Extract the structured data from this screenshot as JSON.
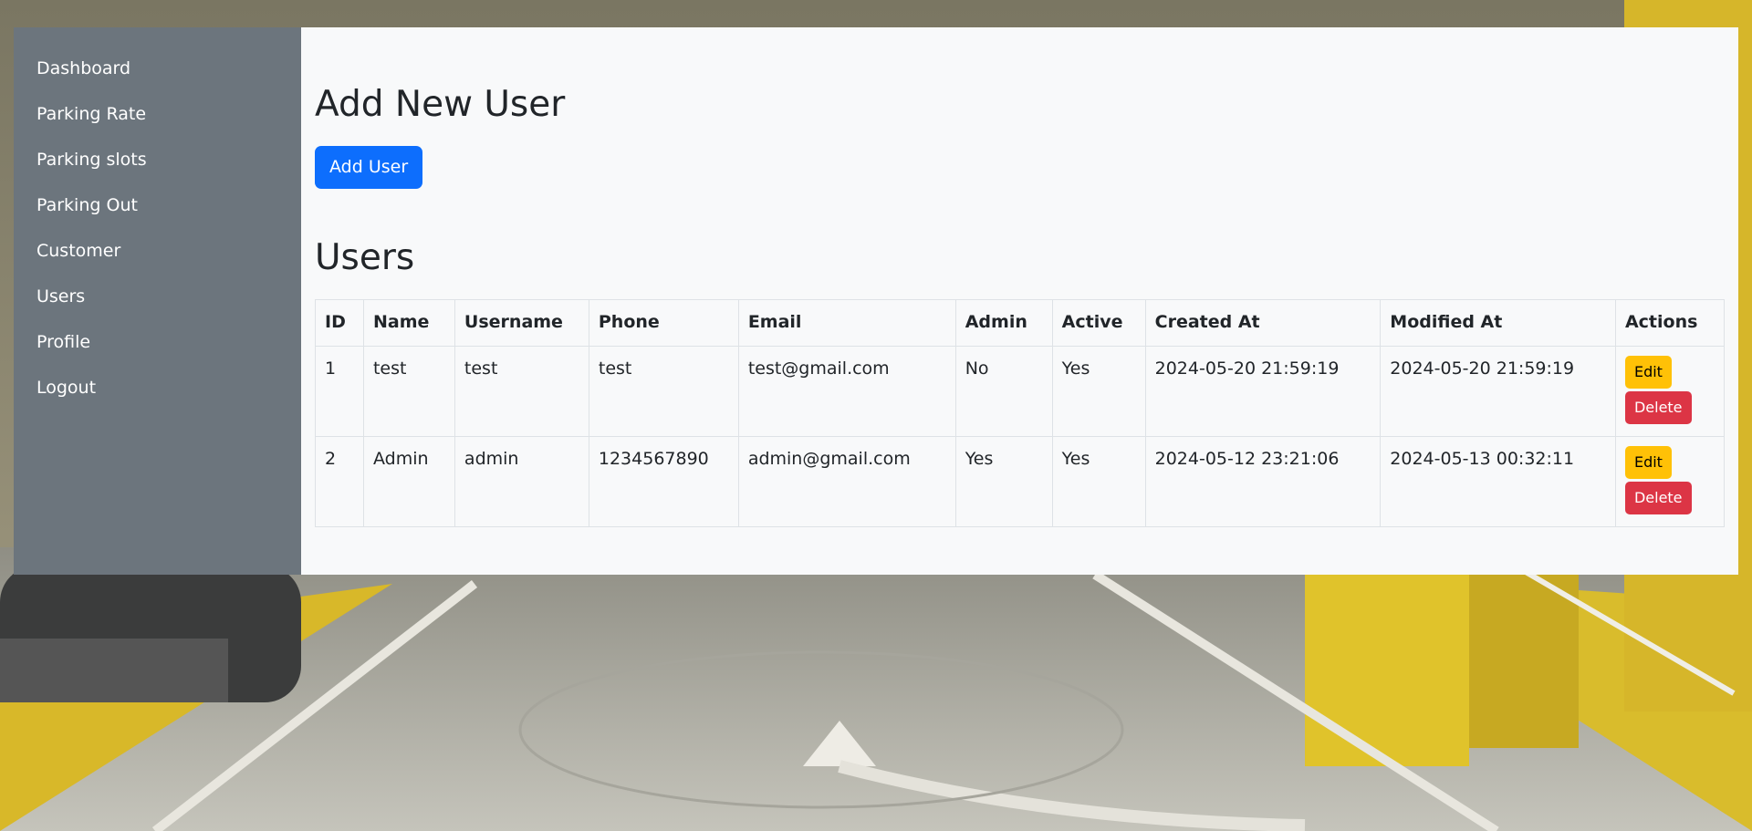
{
  "sidebar": {
    "items": [
      {
        "label": "Dashboard"
      },
      {
        "label": "Parking Rate"
      },
      {
        "label": "Parking slots"
      },
      {
        "label": "Parking Out"
      },
      {
        "label": "Customer"
      },
      {
        "label": "Users"
      },
      {
        "label": "Profile"
      },
      {
        "label": "Logout"
      }
    ]
  },
  "main": {
    "add_heading": "Add New User",
    "add_button": "Add User",
    "users_heading": "Users"
  },
  "table": {
    "headers": [
      "ID",
      "Name",
      "Username",
      "Phone",
      "Email",
      "Admin",
      "Active",
      "Created At",
      "Modified At",
      "Actions"
    ],
    "rows": [
      {
        "id": "1",
        "name": "test",
        "username": "test",
        "phone": "test",
        "email": "test@gmail.com",
        "admin": "No",
        "active": "Yes",
        "created_at": "2024-05-20 21:59:19",
        "modified_at": "2024-05-20 21:59:19",
        "edit": "Edit",
        "delete": "Delete"
      },
      {
        "id": "2",
        "name": "Admin",
        "username": "admin",
        "phone": "1234567890",
        "email": "admin@gmail.com",
        "admin": "Yes",
        "active": "Yes",
        "created_at": "2024-05-12 23:21:06",
        "modified_at": "2024-05-13 00:32:11",
        "edit": "Edit",
        "delete": "Delete"
      }
    ]
  },
  "colors": {
    "sidebar_bg": "#6c757d",
    "content_bg": "#f8f9fa",
    "primary": "#0d6efd",
    "warning": "#ffc107",
    "danger": "#dc3545"
  }
}
